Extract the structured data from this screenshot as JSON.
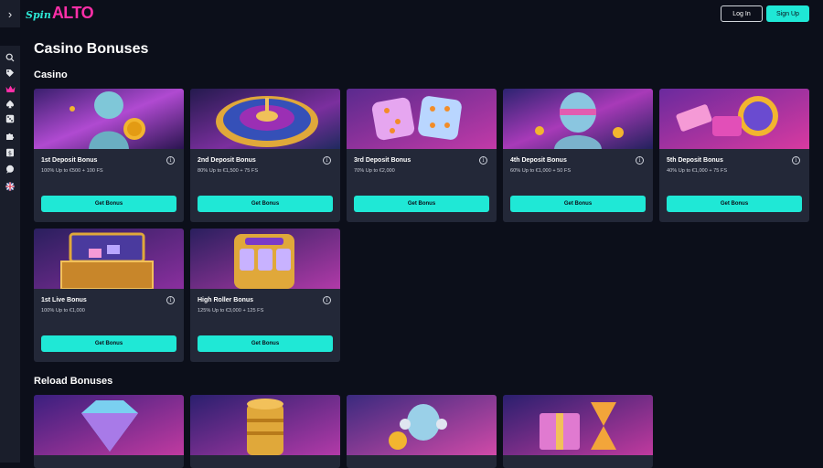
{
  "header": {
    "logo_spin": "Spin",
    "logo_alto": "ALTO",
    "login_label": "Log In",
    "signup_label": "Sign Up"
  },
  "sidebar": {
    "items": [
      "search-icon",
      "tag-icon",
      "crown-icon",
      "spade-icon",
      "dice-icon",
      "puzzle-icon",
      "money-icon",
      "chat-icon",
      "uk-flag-icon"
    ]
  },
  "page": {
    "title": "Casino Bonuses",
    "casino_section": "Casino",
    "reload_section": "Reload Bonuses"
  },
  "casino_bonuses": [
    {
      "name": "1st Deposit Bonus",
      "terms": "100% Up to €500 + 100 FS",
      "button": "Get Bonus"
    },
    {
      "name": "2nd Deposit Bonus",
      "terms": "80% Up to €1,500 + 75 FS",
      "button": "Get Bonus"
    },
    {
      "name": "3rd Deposit Bonus",
      "terms": "70% Up to €2,000",
      "button": "Get Bonus"
    },
    {
      "name": "4th Deposit Bonus",
      "terms": "60% Up to €1,000 + 50 FS",
      "button": "Get Bonus"
    },
    {
      "name": "5th Deposit Bonus",
      "terms": "40% Up to €1,000 + 75 FS",
      "button": "Get Bonus"
    },
    {
      "name": "1st Live Bonus",
      "terms": "100% Up to €1,000",
      "button": "Get Bonus"
    },
    {
      "name": "High Roller Bonus",
      "terms": "125% Up to €3,000 + 125 FS",
      "button": "Get Bonus"
    }
  ],
  "colors": {
    "background": "#0c0f1a",
    "card": "#232838",
    "accent": "#1fe8d6",
    "brand_pink": "#ff2fa8"
  }
}
